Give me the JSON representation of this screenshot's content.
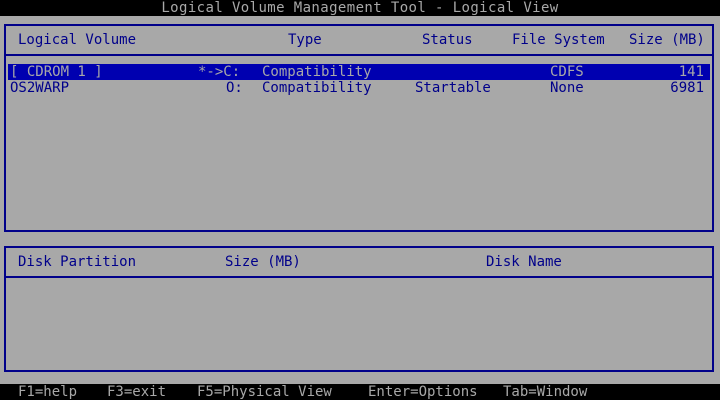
{
  "window": {
    "title": "Logical Volume Management Tool - Logical View"
  },
  "volumes_panel": {
    "columns": {
      "volume": "Logical Volume",
      "type": "Type",
      "status": "Status",
      "filesystem": "File System",
      "size": "Size (MB)"
    },
    "rows": [
      {
        "name": "[ CDROM 1 ]",
        "drive": "*->C:",
        "type": "Compatibility",
        "status": "",
        "filesystem": "CDFS",
        "size": "141",
        "selected": true
      },
      {
        "name": "OS2WARP",
        "drive": "O:",
        "type": "Compatibility",
        "status": "Startable",
        "filesystem": "None",
        "size": "6981",
        "selected": false
      }
    ]
  },
  "partitions_panel": {
    "columns": {
      "partition": "Disk Partition",
      "size": "Size (MB)",
      "disk": "Disk Name"
    },
    "rows": []
  },
  "footer": {
    "keys": [
      "F1=help",
      "F3=exit",
      "F5=Physical View",
      "Enter=Options",
      "Tab=Window"
    ]
  },
  "colors": {
    "background": "#a8a8a8",
    "text": "#00008a",
    "selection": "#0000b0",
    "bar": "#000000"
  }
}
